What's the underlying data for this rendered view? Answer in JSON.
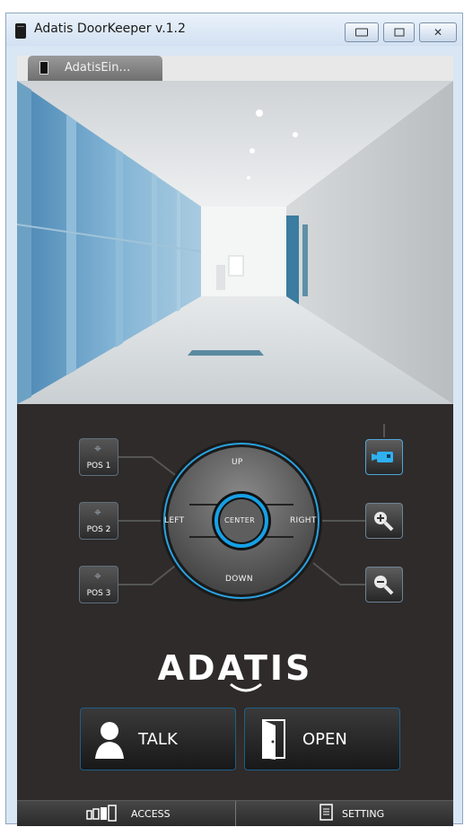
{
  "window": {
    "title": "Adatis DoorKeeper v.1.2"
  },
  "tab": {
    "label": "AdatisEin…"
  },
  "presets": [
    {
      "label": "POS 1"
    },
    {
      "label": "POS 2"
    },
    {
      "label": "POS 3"
    }
  ],
  "dpad": {
    "up": "UP",
    "down": "DOWN",
    "left": "LEFT",
    "right": "RIGHT",
    "center": "CENTER"
  },
  "logo": "ADATIS",
  "actions": {
    "talk": "TALK",
    "open": "OPEN"
  },
  "bottom": {
    "access": "ACCESS",
    "setting": "SETTING"
  },
  "colors": {
    "panel": "#2e2b2a",
    "accent": "#16a0e6",
    "button_border": "#1e5f8a"
  }
}
